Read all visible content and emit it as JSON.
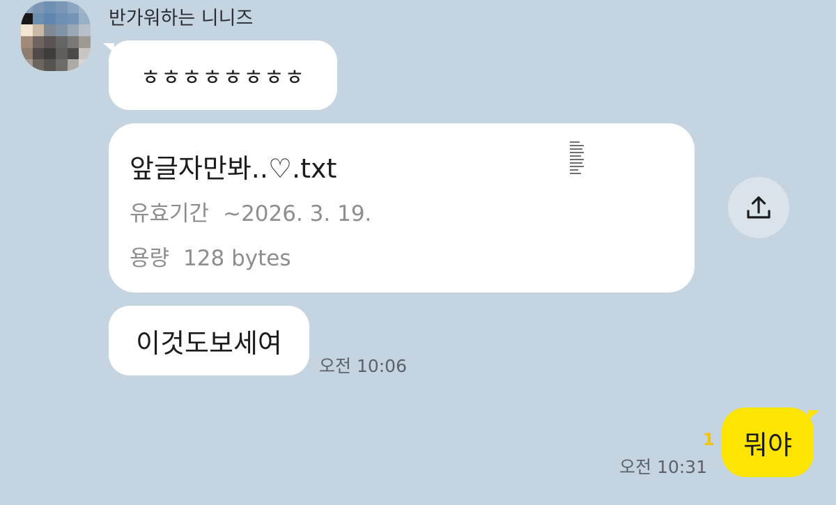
{
  "sender": {
    "name": "반가워하는 니니즈",
    "avatar_colors": [
      "#8aa3bd",
      "#7b97b6",
      "#6e90b4",
      "#7a97b8",
      "#8aa5c0",
      "#9fb4c8",
      "#1a1616",
      "#6c8fb0",
      "#5e86ae",
      "#6d90b3",
      "#7494b5",
      "#98b0c6",
      "#f2e6d2",
      "#c8b9a4",
      "#7f8a95",
      "#8193a6",
      "#9aa7b4",
      "#b7c0c8",
      "#a08b78",
      "#6f6560",
      "#5a5552",
      "#666565",
      "#7b7976",
      "#9e9a92",
      "#8e7d6f",
      "#4f4a47",
      "#3e3c3b",
      "#5f5e5d",
      "#4c4b4a",
      "#c9c6c2",
      "#a59a90",
      "#6b6560",
      "#57534f",
      "#6e6b68",
      "#adaba6",
      "#d9d6d1"
    ]
  },
  "messages": {
    "msg1_text": "ㅎㅎㅎㅎㅎㅎㅎㅎ",
    "file": {
      "name": "앞글자만봐..♡.txt",
      "expiry_label": "유효기간",
      "expiry_value": "~2026. 3. 19.",
      "size_label": "용량",
      "size_value": "128 bytes",
      "share_icon": "share-upload-icon"
    },
    "msg3_text": "이것도보세여",
    "time_in": "오전 10:06"
  },
  "outgoing": {
    "text": "뭐야",
    "unread_count": "1",
    "time": "오전 10:31",
    "bubble_color": "#fee500"
  },
  "colors": {
    "background": "#c5d4e1",
    "incoming_bubble": "#ffffff",
    "unread": "#f2c300"
  }
}
